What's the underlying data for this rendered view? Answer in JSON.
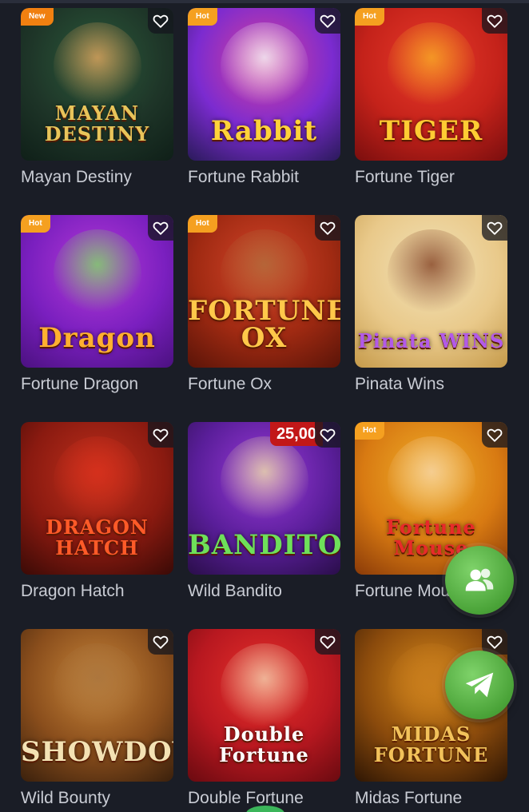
{
  "games": [
    {
      "title": "Mayan Destiny",
      "badge": "New",
      "logo": "MAYAN DESTINY",
      "bg": [
        "#2b5a3a",
        "#1e3528",
        "#0f1f18"
      ],
      "logo_color": "#e8c45a",
      "figure": "#d9a15c"
    },
    {
      "title": "Fortune Rabbit",
      "badge": "Hot",
      "logo": "Rabbit",
      "bg": [
        "#d9409a",
        "#7b2bd0",
        "#2a1a5a"
      ],
      "logo_color": "#ffd23a",
      "figure": "#f1f1f8"
    },
    {
      "title": "Fortune Tiger",
      "badge": "Hot",
      "logo": "TIGER",
      "bg": [
        "#e83a2a",
        "#c4221a",
        "#7a0e0e"
      ],
      "logo_color": "#ffcc33",
      "figure": "#f6a624"
    },
    {
      "title": "Fortune Dragon",
      "badge": "Hot",
      "logo": "Dragon",
      "bg": [
        "#b53ad6",
        "#7a1fbf",
        "#4b1180"
      ],
      "logo_color": "#ffb030",
      "figure": "#7ed06a"
    },
    {
      "title": "Fortune Ox",
      "badge": "Hot",
      "logo": "FORTUNE OX",
      "bg": [
        "#d4452a",
        "#a02a12",
        "#5a1408"
      ],
      "logo_color": "#ffc84a",
      "figure": "#b06a3a"
    },
    {
      "title": "Pinata Wins",
      "badge": "",
      "logo": "Pinata WINS",
      "bg": [
        "#f2e2b8",
        "#e9c98a",
        "#c59a4a"
      ],
      "logo_color": "#b25ae8",
      "figure": "#8a4a2a"
    },
    {
      "title": "Dragon Hatch",
      "badge": "",
      "logo": "DRAGON HATCH",
      "bg": [
        "#c0301c",
        "#8a1a10",
        "#3a0a06"
      ],
      "logo_color": "#ff5a28",
      "figure": "#d8301c"
    },
    {
      "title": "Wild Bandito",
      "badge": "",
      "price": "25,00",
      "logo": "BANDITO",
      "bg": [
        "#9a3ad8",
        "#5a1e9a",
        "#2a0e4a"
      ],
      "logo_color": "#6ee05a",
      "figure": "#e8d6a8"
    },
    {
      "title": "Fortune Mouse",
      "badge": "Hot",
      "logo": "Fortune Mouse",
      "bg": [
        "#f0b02a",
        "#d87a12",
        "#8a3a08"
      ],
      "logo_color": "#e82a2a",
      "figure": "#f6d2a2"
    },
    {
      "title": "Wild Bounty",
      "badge": "",
      "logo": "SHOWDOWN",
      "bg": [
        "#c8863a",
        "#8a4e1c",
        "#3a200c"
      ],
      "logo_color": "#f3e2b4",
      "figure": "#a8743e"
    },
    {
      "title": "Double Fortune",
      "badge": "",
      "logo": "Double Fortune",
      "bg": [
        "#e8302a",
        "#b81820",
        "#6a0a10"
      ],
      "logo_color": "#ffffff",
      "figure": "#f0c8a8"
    },
    {
      "title": "Midas Fortune",
      "badge": "",
      "logo": "MIDAS FORTUNE",
      "bg": [
        "#d88a1a",
        "#8a4a0c",
        "#2e1604"
      ],
      "logo_color": "#f2c25a",
      "figure": "#c47a1e"
    }
  ],
  "floating": {
    "community_icon": "users-icon",
    "telegram_icon": "paper-plane-icon"
  },
  "colors": {
    "background": "#1a1d26",
    "title_text": "#c9ccd4",
    "float_green": "#4aa338"
  }
}
